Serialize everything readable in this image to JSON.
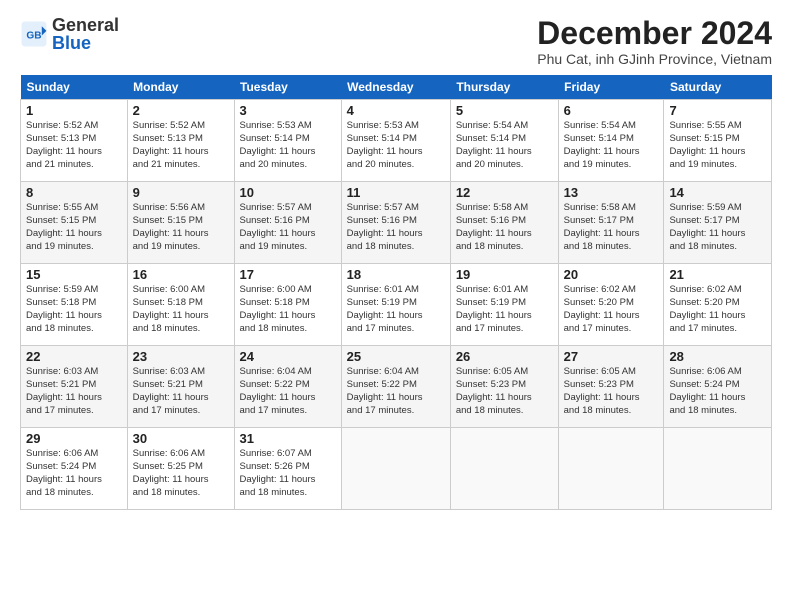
{
  "logo": {
    "general": "General",
    "blue": "Blue"
  },
  "header": {
    "title": "December 2024",
    "subtitle": "Phu Cat, inh GJinh Province, Vietnam"
  },
  "weekdays": [
    "Sunday",
    "Monday",
    "Tuesday",
    "Wednesday",
    "Thursday",
    "Friday",
    "Saturday"
  ],
  "weeks": [
    [
      {
        "day": "1",
        "info": "Sunrise: 5:52 AM\nSunset: 5:13 PM\nDaylight: 11 hours\nand 21 minutes."
      },
      {
        "day": "2",
        "info": "Sunrise: 5:52 AM\nSunset: 5:13 PM\nDaylight: 11 hours\nand 21 minutes."
      },
      {
        "day": "3",
        "info": "Sunrise: 5:53 AM\nSunset: 5:14 PM\nDaylight: 11 hours\nand 20 minutes."
      },
      {
        "day": "4",
        "info": "Sunrise: 5:53 AM\nSunset: 5:14 PM\nDaylight: 11 hours\nand 20 minutes."
      },
      {
        "day": "5",
        "info": "Sunrise: 5:54 AM\nSunset: 5:14 PM\nDaylight: 11 hours\nand 20 minutes."
      },
      {
        "day": "6",
        "info": "Sunrise: 5:54 AM\nSunset: 5:14 PM\nDaylight: 11 hours\nand 19 minutes."
      },
      {
        "day": "7",
        "info": "Sunrise: 5:55 AM\nSunset: 5:15 PM\nDaylight: 11 hours\nand 19 minutes."
      }
    ],
    [
      {
        "day": "8",
        "info": "Sunrise: 5:55 AM\nSunset: 5:15 PM\nDaylight: 11 hours\nand 19 minutes."
      },
      {
        "day": "9",
        "info": "Sunrise: 5:56 AM\nSunset: 5:15 PM\nDaylight: 11 hours\nand 19 minutes."
      },
      {
        "day": "10",
        "info": "Sunrise: 5:57 AM\nSunset: 5:16 PM\nDaylight: 11 hours\nand 19 minutes."
      },
      {
        "day": "11",
        "info": "Sunrise: 5:57 AM\nSunset: 5:16 PM\nDaylight: 11 hours\nand 18 minutes."
      },
      {
        "day": "12",
        "info": "Sunrise: 5:58 AM\nSunset: 5:16 PM\nDaylight: 11 hours\nand 18 minutes."
      },
      {
        "day": "13",
        "info": "Sunrise: 5:58 AM\nSunset: 5:17 PM\nDaylight: 11 hours\nand 18 minutes."
      },
      {
        "day": "14",
        "info": "Sunrise: 5:59 AM\nSunset: 5:17 PM\nDaylight: 11 hours\nand 18 minutes."
      }
    ],
    [
      {
        "day": "15",
        "info": "Sunrise: 5:59 AM\nSunset: 5:18 PM\nDaylight: 11 hours\nand 18 minutes."
      },
      {
        "day": "16",
        "info": "Sunrise: 6:00 AM\nSunset: 5:18 PM\nDaylight: 11 hours\nand 18 minutes."
      },
      {
        "day": "17",
        "info": "Sunrise: 6:00 AM\nSunset: 5:18 PM\nDaylight: 11 hours\nand 18 minutes."
      },
      {
        "day": "18",
        "info": "Sunrise: 6:01 AM\nSunset: 5:19 PM\nDaylight: 11 hours\nand 17 minutes."
      },
      {
        "day": "19",
        "info": "Sunrise: 6:01 AM\nSunset: 5:19 PM\nDaylight: 11 hours\nand 17 minutes."
      },
      {
        "day": "20",
        "info": "Sunrise: 6:02 AM\nSunset: 5:20 PM\nDaylight: 11 hours\nand 17 minutes."
      },
      {
        "day": "21",
        "info": "Sunrise: 6:02 AM\nSunset: 5:20 PM\nDaylight: 11 hours\nand 17 minutes."
      }
    ],
    [
      {
        "day": "22",
        "info": "Sunrise: 6:03 AM\nSunset: 5:21 PM\nDaylight: 11 hours\nand 17 minutes."
      },
      {
        "day": "23",
        "info": "Sunrise: 6:03 AM\nSunset: 5:21 PM\nDaylight: 11 hours\nand 17 minutes."
      },
      {
        "day": "24",
        "info": "Sunrise: 6:04 AM\nSunset: 5:22 PM\nDaylight: 11 hours\nand 17 minutes."
      },
      {
        "day": "25",
        "info": "Sunrise: 6:04 AM\nSunset: 5:22 PM\nDaylight: 11 hours\nand 17 minutes."
      },
      {
        "day": "26",
        "info": "Sunrise: 6:05 AM\nSunset: 5:23 PM\nDaylight: 11 hours\nand 18 minutes."
      },
      {
        "day": "27",
        "info": "Sunrise: 6:05 AM\nSunset: 5:23 PM\nDaylight: 11 hours\nand 18 minutes."
      },
      {
        "day": "28",
        "info": "Sunrise: 6:06 AM\nSunset: 5:24 PM\nDaylight: 11 hours\nand 18 minutes."
      }
    ],
    [
      {
        "day": "29",
        "info": "Sunrise: 6:06 AM\nSunset: 5:24 PM\nDaylight: 11 hours\nand 18 minutes."
      },
      {
        "day": "30",
        "info": "Sunrise: 6:06 AM\nSunset: 5:25 PM\nDaylight: 11 hours\nand 18 minutes."
      },
      {
        "day": "31",
        "info": "Sunrise: 6:07 AM\nSunset: 5:26 PM\nDaylight: 11 hours\nand 18 minutes."
      },
      null,
      null,
      null,
      null
    ]
  ]
}
